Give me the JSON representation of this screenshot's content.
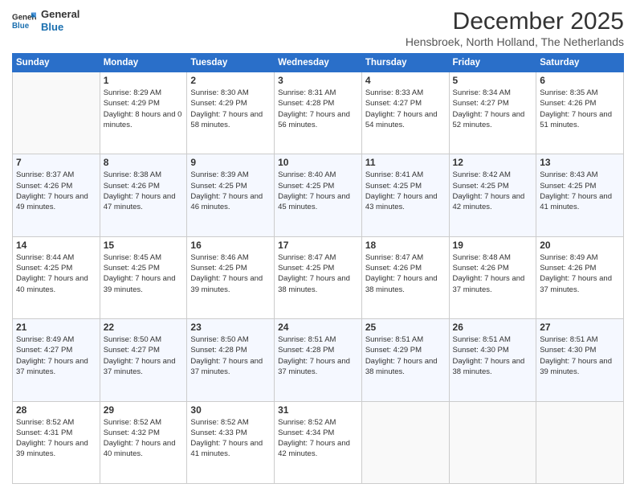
{
  "logo": {
    "line1": "General",
    "line2": "Blue"
  },
  "title": "December 2025",
  "subtitle": "Hensbroek, North Holland, The Netherlands",
  "weekdays": [
    "Sunday",
    "Monday",
    "Tuesday",
    "Wednesday",
    "Thursday",
    "Friday",
    "Saturday"
  ],
  "weeks": [
    [
      {
        "day": "",
        "sunrise": "",
        "sunset": "",
        "daylight": ""
      },
      {
        "day": "1",
        "sunrise": "Sunrise: 8:29 AM",
        "sunset": "Sunset: 4:29 PM",
        "daylight": "Daylight: 8 hours and 0 minutes."
      },
      {
        "day": "2",
        "sunrise": "Sunrise: 8:30 AM",
        "sunset": "Sunset: 4:29 PM",
        "daylight": "Daylight: 7 hours and 58 minutes."
      },
      {
        "day": "3",
        "sunrise": "Sunrise: 8:31 AM",
        "sunset": "Sunset: 4:28 PM",
        "daylight": "Daylight: 7 hours and 56 minutes."
      },
      {
        "day": "4",
        "sunrise": "Sunrise: 8:33 AM",
        "sunset": "Sunset: 4:27 PM",
        "daylight": "Daylight: 7 hours and 54 minutes."
      },
      {
        "day": "5",
        "sunrise": "Sunrise: 8:34 AM",
        "sunset": "Sunset: 4:27 PM",
        "daylight": "Daylight: 7 hours and 52 minutes."
      },
      {
        "day": "6",
        "sunrise": "Sunrise: 8:35 AM",
        "sunset": "Sunset: 4:26 PM",
        "daylight": "Daylight: 7 hours and 51 minutes."
      }
    ],
    [
      {
        "day": "7",
        "sunrise": "Sunrise: 8:37 AM",
        "sunset": "Sunset: 4:26 PM",
        "daylight": "Daylight: 7 hours and 49 minutes."
      },
      {
        "day": "8",
        "sunrise": "Sunrise: 8:38 AM",
        "sunset": "Sunset: 4:26 PM",
        "daylight": "Daylight: 7 hours and 47 minutes."
      },
      {
        "day": "9",
        "sunrise": "Sunrise: 8:39 AM",
        "sunset": "Sunset: 4:25 PM",
        "daylight": "Daylight: 7 hours and 46 minutes."
      },
      {
        "day": "10",
        "sunrise": "Sunrise: 8:40 AM",
        "sunset": "Sunset: 4:25 PM",
        "daylight": "Daylight: 7 hours and 45 minutes."
      },
      {
        "day": "11",
        "sunrise": "Sunrise: 8:41 AM",
        "sunset": "Sunset: 4:25 PM",
        "daylight": "Daylight: 7 hours and 43 minutes."
      },
      {
        "day": "12",
        "sunrise": "Sunrise: 8:42 AM",
        "sunset": "Sunset: 4:25 PM",
        "daylight": "Daylight: 7 hours and 42 minutes."
      },
      {
        "day": "13",
        "sunrise": "Sunrise: 8:43 AM",
        "sunset": "Sunset: 4:25 PM",
        "daylight": "Daylight: 7 hours and 41 minutes."
      }
    ],
    [
      {
        "day": "14",
        "sunrise": "Sunrise: 8:44 AM",
        "sunset": "Sunset: 4:25 PM",
        "daylight": "Daylight: 7 hours and 40 minutes."
      },
      {
        "day": "15",
        "sunrise": "Sunrise: 8:45 AM",
        "sunset": "Sunset: 4:25 PM",
        "daylight": "Daylight: 7 hours and 39 minutes."
      },
      {
        "day": "16",
        "sunrise": "Sunrise: 8:46 AM",
        "sunset": "Sunset: 4:25 PM",
        "daylight": "Daylight: 7 hours and 39 minutes."
      },
      {
        "day": "17",
        "sunrise": "Sunrise: 8:47 AM",
        "sunset": "Sunset: 4:25 PM",
        "daylight": "Daylight: 7 hours and 38 minutes."
      },
      {
        "day": "18",
        "sunrise": "Sunrise: 8:47 AM",
        "sunset": "Sunset: 4:26 PM",
        "daylight": "Daylight: 7 hours and 38 minutes."
      },
      {
        "day": "19",
        "sunrise": "Sunrise: 8:48 AM",
        "sunset": "Sunset: 4:26 PM",
        "daylight": "Daylight: 7 hours and 37 minutes."
      },
      {
        "day": "20",
        "sunrise": "Sunrise: 8:49 AM",
        "sunset": "Sunset: 4:26 PM",
        "daylight": "Daylight: 7 hours and 37 minutes."
      }
    ],
    [
      {
        "day": "21",
        "sunrise": "Sunrise: 8:49 AM",
        "sunset": "Sunset: 4:27 PM",
        "daylight": "Daylight: 7 hours and 37 minutes."
      },
      {
        "day": "22",
        "sunrise": "Sunrise: 8:50 AM",
        "sunset": "Sunset: 4:27 PM",
        "daylight": "Daylight: 7 hours and 37 minutes."
      },
      {
        "day": "23",
        "sunrise": "Sunrise: 8:50 AM",
        "sunset": "Sunset: 4:28 PM",
        "daylight": "Daylight: 7 hours and 37 minutes."
      },
      {
        "day": "24",
        "sunrise": "Sunrise: 8:51 AM",
        "sunset": "Sunset: 4:28 PM",
        "daylight": "Daylight: 7 hours and 37 minutes."
      },
      {
        "day": "25",
        "sunrise": "Sunrise: 8:51 AM",
        "sunset": "Sunset: 4:29 PM",
        "daylight": "Daylight: 7 hours and 38 minutes."
      },
      {
        "day": "26",
        "sunrise": "Sunrise: 8:51 AM",
        "sunset": "Sunset: 4:30 PM",
        "daylight": "Daylight: 7 hours and 38 minutes."
      },
      {
        "day": "27",
        "sunrise": "Sunrise: 8:51 AM",
        "sunset": "Sunset: 4:30 PM",
        "daylight": "Daylight: 7 hours and 39 minutes."
      }
    ],
    [
      {
        "day": "28",
        "sunrise": "Sunrise: 8:52 AM",
        "sunset": "Sunset: 4:31 PM",
        "daylight": "Daylight: 7 hours and 39 minutes."
      },
      {
        "day": "29",
        "sunrise": "Sunrise: 8:52 AM",
        "sunset": "Sunset: 4:32 PM",
        "daylight": "Daylight: 7 hours and 40 minutes."
      },
      {
        "day": "30",
        "sunrise": "Sunrise: 8:52 AM",
        "sunset": "Sunset: 4:33 PM",
        "daylight": "Daylight: 7 hours and 41 minutes."
      },
      {
        "day": "31",
        "sunrise": "Sunrise: 8:52 AM",
        "sunset": "Sunset: 4:34 PM",
        "daylight": "Daylight: 7 hours and 42 minutes."
      },
      {
        "day": "",
        "sunrise": "",
        "sunset": "",
        "daylight": ""
      },
      {
        "day": "",
        "sunrise": "",
        "sunset": "",
        "daylight": ""
      },
      {
        "day": "",
        "sunrise": "",
        "sunset": "",
        "daylight": ""
      }
    ]
  ]
}
